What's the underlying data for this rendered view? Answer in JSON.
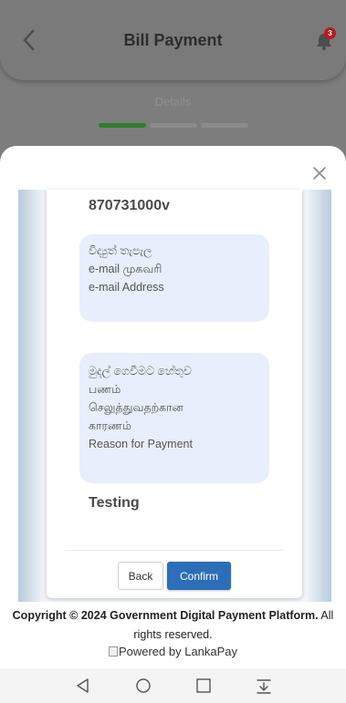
{
  "header": {
    "title": "Bill Payment",
    "notification_count": "3"
  },
  "stepper": {
    "label": "Details",
    "steps_total": 3,
    "steps_complete": 1
  },
  "sheet": {
    "id_value": "870731000v",
    "email_labels": [
      "විද්‍යුත් තැපැල",
      "e-mail முகவரி",
      "e-mail Address"
    ],
    "reason_labels": [
      "මුදල් ගෙවීමට හේතුව",
      "பணம்",
      "செலுத்துவதற்கான",
      "காரணம்",
      "Reason for Payment"
    ],
    "reason_value": "Testing",
    "back_label": "Back",
    "confirm_label": "Confirm"
  },
  "footer": {
    "copyright_bold": "Copyright © 2024 Government Digital Payment Platform.",
    "copyright_rest": " All rights reserved.",
    "powered_by": "Powered by LankaPay"
  },
  "colors": {
    "accent": "#2c6fb8",
    "step_active": "#2e7f28",
    "badge": "#b81c1c",
    "field_bg": "#e8eefb"
  },
  "icons": {
    "back": "chevron-left-icon",
    "bell": "bell-icon",
    "close": "close-icon",
    "nav": [
      "nav-back-icon",
      "nav-home-icon",
      "nav-recents-icon",
      "nav-menu-icon"
    ]
  }
}
